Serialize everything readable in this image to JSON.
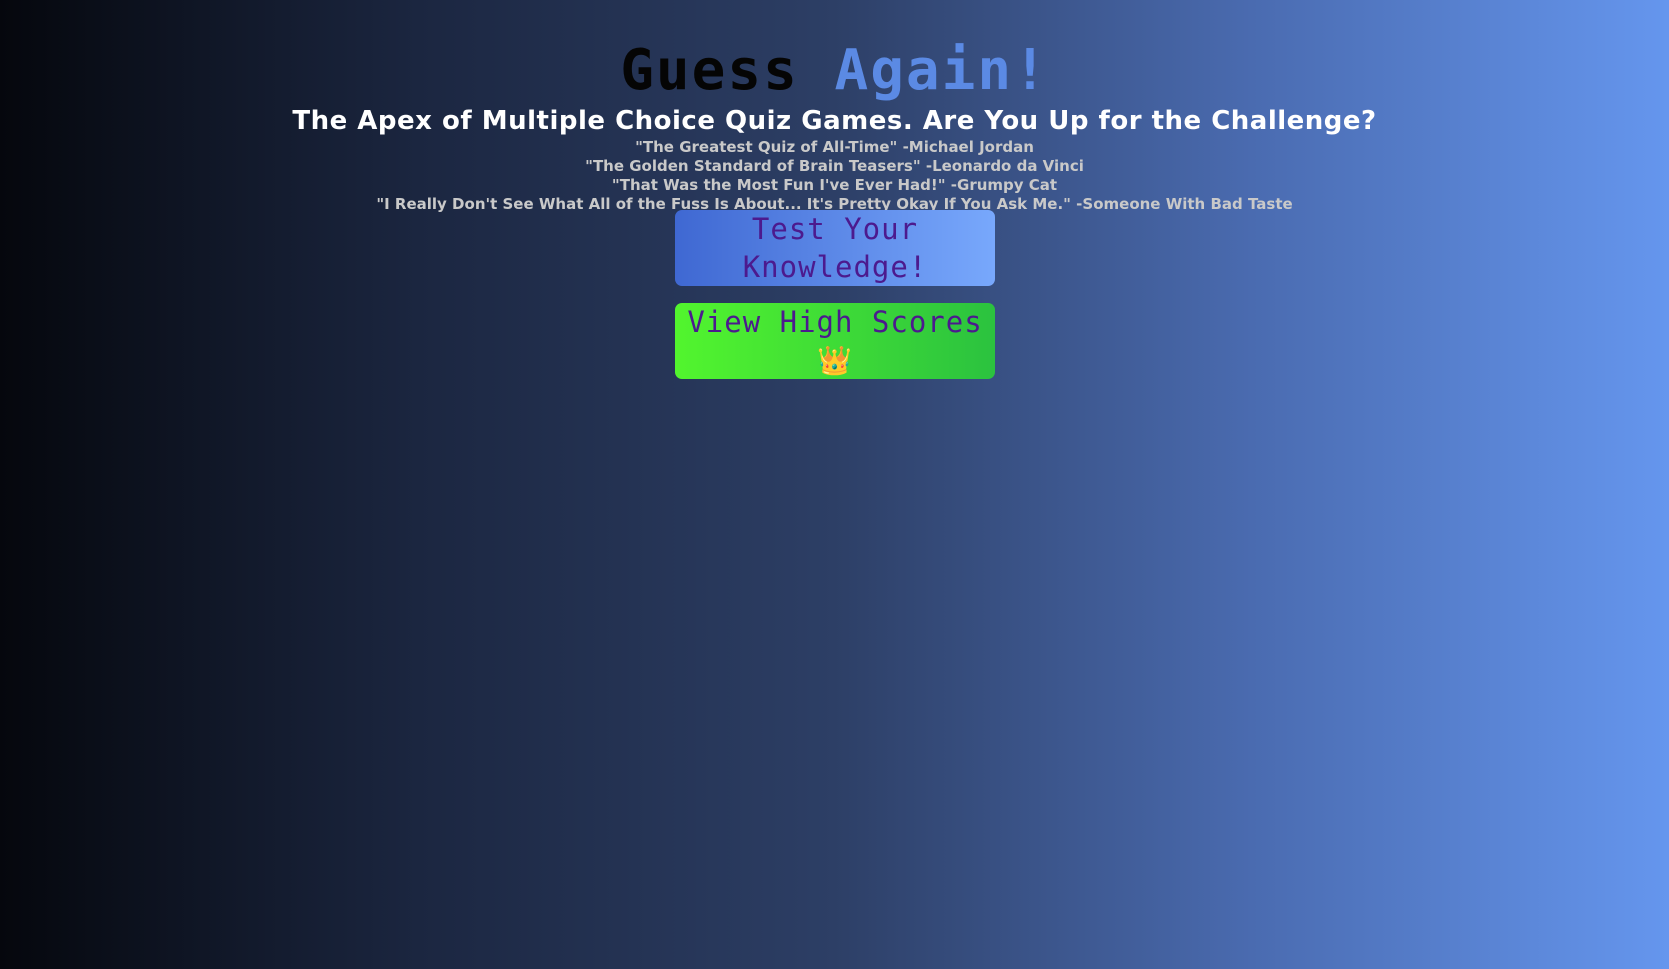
{
  "title": {
    "part1": "Guess",
    "part2": "Again!"
  },
  "subtitle": "The Apex of Multiple Choice Quiz Games. Are You Up for the Challenge?",
  "quotes": [
    "\"The Greatest Quiz of All-Time\" -Michael Jordan",
    "\"The Golden Standard of Brain Teasers\" -Leonardo da Vinci",
    "\"That Was the Most Fun I've Ever Had!\" -Grumpy Cat",
    "\"I Really Don't See What All of the Fuss Is About... It's Pretty Okay If You Ask Me.\" -Someone With Bad Taste"
  ],
  "buttons": {
    "test": {
      "line1": "Test Your",
      "line2": "Knowledge!"
    },
    "scores": {
      "label": "View High Scores",
      "icon": "👑",
      "icon_name": "crown-icon"
    }
  },
  "colors": {
    "title_accent": "#5b8ae4",
    "button_text": "#4c1a8e",
    "test_button_gradient": [
      "#3f68d2",
      "#78a8fc"
    ],
    "scores_button_gradient": [
      "#52f52e",
      "#2bc23f"
    ]
  }
}
